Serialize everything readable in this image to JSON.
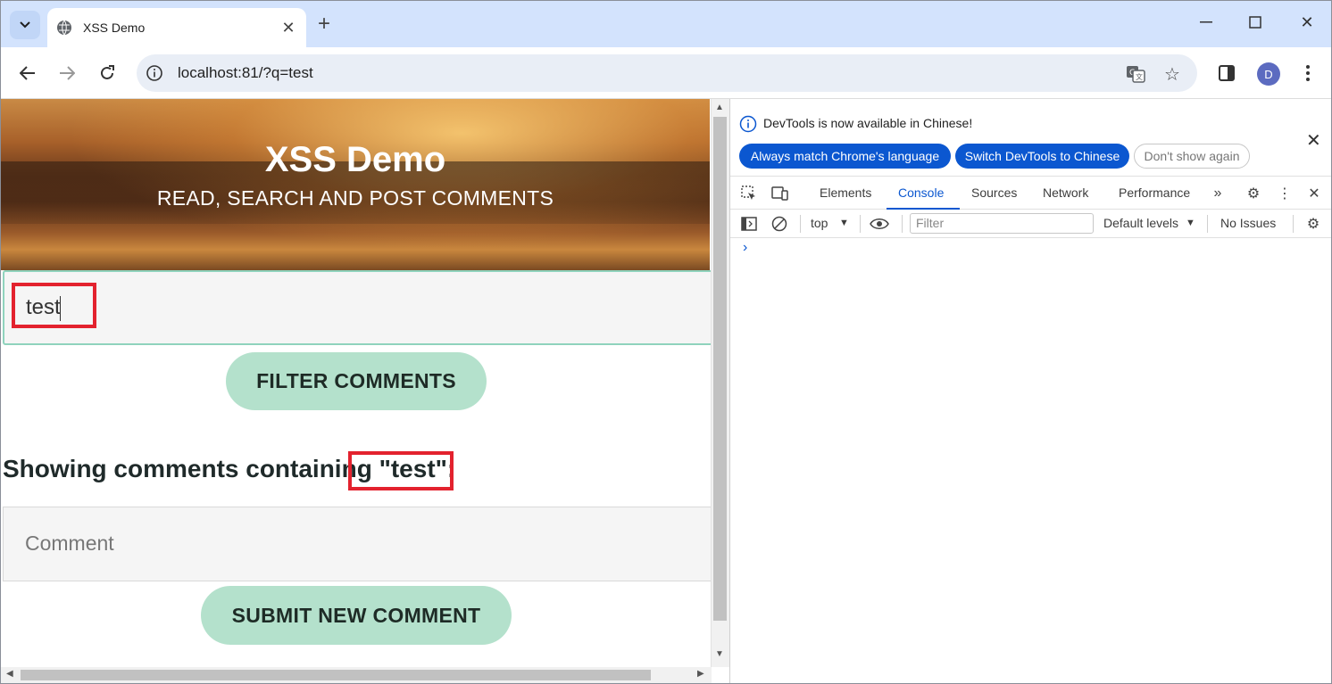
{
  "browser": {
    "tab_title": "XSS Demo",
    "url": "localhost:81/?q=test",
    "avatar_letter": "D"
  },
  "page": {
    "hero_title": "XSS Demo",
    "hero_subtitle": "READ, SEARCH AND POST COMMENTS",
    "search_value": "test",
    "filter_button": "FILTER COMMENTS",
    "showing_text": "Showing comments containing \"test\":",
    "comment_placeholder": "Comment",
    "submit_button": "SUBMIT NEW COMMENT"
  },
  "devtools": {
    "banner_message": "DevTools is now available in Chinese!",
    "banner_buttons": [
      "Always match Chrome's language",
      "Switch DevTools to Chinese",
      "Don't show again"
    ],
    "tabs": [
      "Elements",
      "Console",
      "Sources",
      "Network",
      "Performance"
    ],
    "active_tab": "Console",
    "context": "top",
    "filter_placeholder": "Filter",
    "levels": "Default levels",
    "issues": "No Issues",
    "prompt": "›"
  },
  "colors": {
    "highlight_box": "#e3222e",
    "button_bg": "#b4e1cc",
    "devtools_accent": "#0b57d0"
  }
}
